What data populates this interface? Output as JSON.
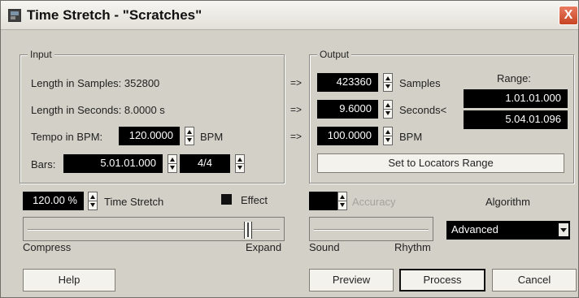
{
  "window": {
    "title": "Time Stretch - \"Scratches\"",
    "close_glyph": "X"
  },
  "input": {
    "group_label": "Input",
    "length_samples_label": "Length in Samples: 352800",
    "length_seconds_label": "Length in Seconds: 8.0000 s",
    "tempo_label": "Tempo in BPM:",
    "tempo_value": "120.0000",
    "tempo_unit": "BPM",
    "bars_label": "Bars:",
    "bars_value": "5.01.01.000",
    "signature_value": "4/4"
  },
  "arrows": [
    "=>",
    "=>",
    "=>"
  ],
  "output": {
    "group_label": "Output",
    "samples_value": "423360",
    "samples_label": "Samples",
    "seconds_value": "9.6000",
    "seconds_label": "Seconds<",
    "bpm_value": "100.0000",
    "bpm_label": "BPM",
    "range_label": "Range:",
    "range_start": "1.01.01.000",
    "range_end": "5.04.01.096",
    "set_locators_label": "Set to Locators Range"
  },
  "stretch": {
    "value": "120.00 %",
    "label": "Time Stretch",
    "effect_label": "Effect",
    "compress_label": "Compress",
    "expand_label": "Expand",
    "slider_position": 0.88
  },
  "accuracy": {
    "label": "Accuracy",
    "sound_label": "Sound",
    "rhythm_label": "Rhythm"
  },
  "algorithm": {
    "label": "Algorithm",
    "selected": "Advanced"
  },
  "buttons": {
    "help": "Help",
    "preview": "Preview",
    "process": "Process",
    "cancel": "Cancel"
  }
}
